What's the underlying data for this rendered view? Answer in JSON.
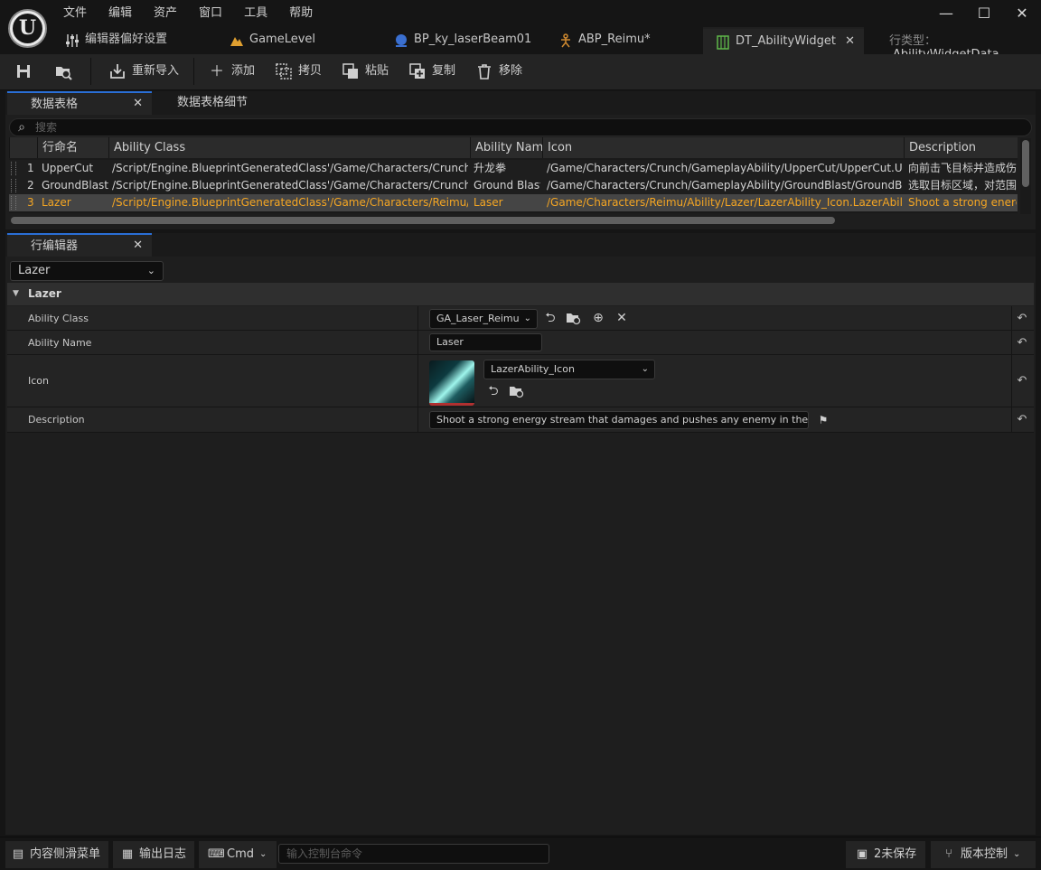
{
  "menu": [
    "文件",
    "编辑",
    "资产",
    "窗口",
    "工具",
    "帮助"
  ],
  "window_controls": {
    "minimize": "—",
    "maximize": "☐",
    "close": "✕"
  },
  "tabs": [
    {
      "label": "编辑器偏好设置",
      "icon": "sliders-icon"
    },
    {
      "label": "GameLevel",
      "icon": "level-icon"
    },
    {
      "label": "BP_ky_laserBeam01",
      "icon": "blueprint-icon"
    },
    {
      "label": "ABP_Reimu*",
      "icon": "anim-blueprint-icon"
    },
    {
      "label": "DT_AbilityWidget",
      "icon": "datatable-icon",
      "active": true
    }
  ],
  "row_type": {
    "label": "行类型：",
    "value": "AbilityWidgetData"
  },
  "toolbar": {
    "reimport": "重新导入",
    "add": "添加",
    "copy": "拷贝",
    "paste": "粘贴",
    "duplicate": "复制",
    "remove": "移除"
  },
  "datatable_panel": {
    "tab_table": "数据表格",
    "tab_details": "数据表格细节",
    "search_placeholder": "搜索",
    "columns": [
      "行命名",
      "Ability Class",
      "Ability Name",
      "Icon",
      "Description"
    ],
    "rows": [
      {
        "index": "1",
        "name": "UpperCut",
        "ability_class": "/Script/Engine.BlueprintGeneratedClass'/Game/Characters/Crunch/GameplayAbility/UpperCut/GA_UpperCut.GA_UpperCut_C'",
        "ability_name": "升龙拳",
        "icon": "/Game/Characters/Crunch/GameplayAbility/UpperCut/UpperCut.UpperCut",
        "description": "向前击飞目标并造成伤害"
      },
      {
        "index": "2",
        "name": "GroundBlast",
        "ability_class": "/Script/Engine.BlueprintGeneratedClass'/Game/Characters/Crunch/GameplayAbility/GroundBlast/GA_GroundBlast.GA_GroundBlast_C'",
        "ability_name": "Ground Blast",
        "icon": "/Game/Characters/Crunch/GameplayAbility/GroundBlast/GroundBlash.GroundBlash",
        "description": "选取目标区域，对范围内敌人造成伤害"
      },
      {
        "index": "3",
        "name": "Lazer",
        "ability_class": "/Script/Engine.BlueprintGeneratedClass'/Game/Characters/Reimu/Ability/Lazer/GA_Laser_Reimu.GA_Laser_Reimu_C'",
        "ability_name": "Laser",
        "icon": "/Game/Characters/Reimu/Ability/Lazer/LazerAbility_Icon.LazerAbility_Icon",
        "description": "Shoot a strong energy stream that damages and pushes any enemy in the way!",
        "selected": true
      }
    ]
  },
  "row_editor": {
    "tab": "行编辑器",
    "selected_row": "Lazer",
    "category": "Lazer",
    "props": {
      "ability_class_label": "Ability Class",
      "ability_class_value": "GA_Laser_Reimu",
      "ability_name_label": "Ability Name",
      "ability_name_value": "Laser",
      "icon_label": "Icon",
      "icon_value": "LazerAbility_Icon",
      "description_label": "Description",
      "description_value": "Shoot a strong energy stream that damages and pushes any enemy in the way!"
    }
  },
  "statusbar": {
    "content_drawer": "内容侧滑菜单",
    "output_log": "输出日志",
    "cmd": "Cmd",
    "cmd_placeholder": "输入控制台命令",
    "unsaved": "2未保存",
    "source_control": "版本控制"
  },
  "colors": {
    "accent": "#2a6fd6",
    "selected_text": "#f5a623",
    "background": "#151515",
    "panel": "#242424"
  }
}
